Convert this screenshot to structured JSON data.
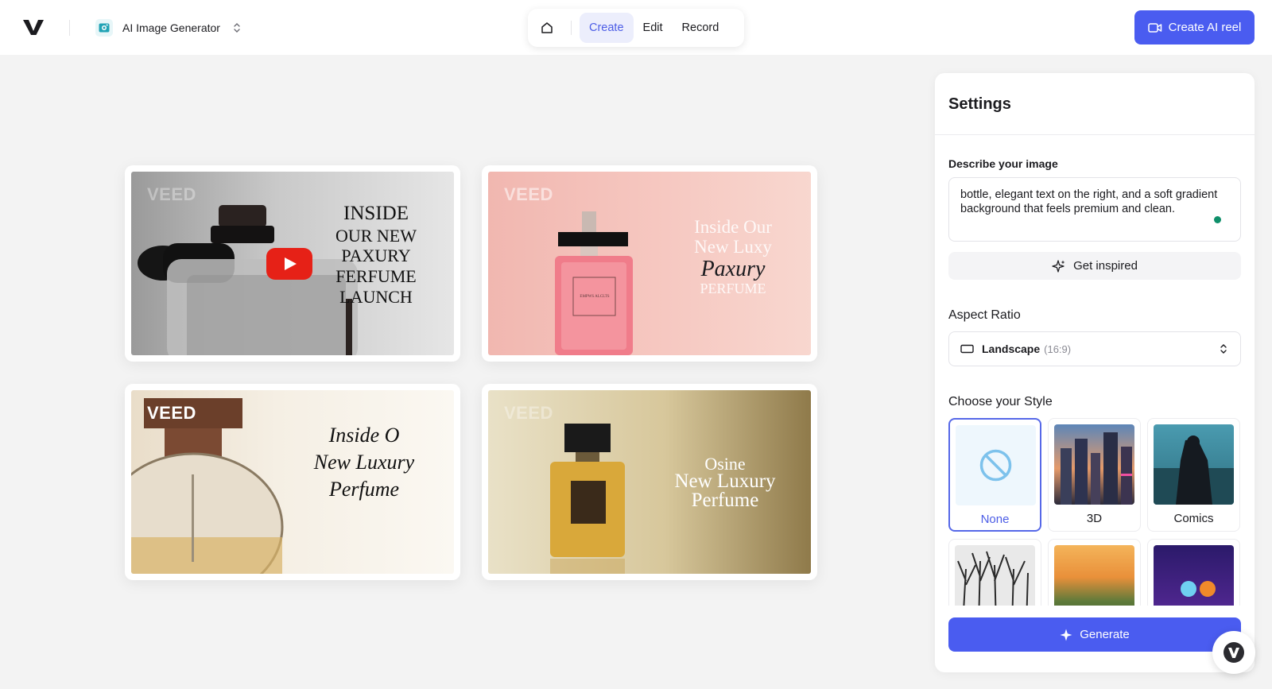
{
  "header": {
    "app_name": "AI Image Generator",
    "nav_tabs": [
      {
        "label": "Create",
        "active": true
      },
      {
        "label": "Edit",
        "active": false
      },
      {
        "label": "Record",
        "active": false
      }
    ],
    "create_reel_label": "Create AI reel"
  },
  "gallery": [
    {
      "watermark": "VEED",
      "lines": [
        "INSIDE",
        "OUR NEW",
        "PAXURY",
        "FERFUME",
        "LAUNCH"
      ],
      "has_play_button": true
    },
    {
      "watermark": "VEED",
      "lines": [
        "Inside Our",
        "New Luxy",
        "Paxury",
        "PERFUME"
      ],
      "bottle_label": "EMPWS ALCLTS"
    },
    {
      "watermark": "VEED",
      "lines": [
        "Inside O",
        "New Luxury",
        "Perfume"
      ]
    },
    {
      "watermark": "VEED",
      "lines": [
        "Osine",
        "New Luxury",
        "Perfume"
      ]
    }
  ],
  "settings": {
    "title": "Settings",
    "describe_label": "Describe your image",
    "prompt_text": "bottle, elegant text on the right, and a soft gradient background that feels premium and clean.",
    "get_inspired_label": "Get inspired",
    "aspect_label": "Aspect Ratio",
    "aspect_value": "Landscape",
    "aspect_ratio": "(16:9)",
    "style_label": "Choose your Style",
    "styles": [
      {
        "name": "None",
        "selected": true
      },
      {
        "name": "3D",
        "selected": false
      },
      {
        "name": "Comics",
        "selected": false
      },
      {
        "name": "",
        "selected": false
      },
      {
        "name": "",
        "selected": false
      },
      {
        "name": "",
        "selected": false
      }
    ],
    "generate_label": "Generate"
  },
  "colors": {
    "accent": "#4a5cf0",
    "background": "#f3f3f3",
    "active_tab_bg": "#eceefc"
  }
}
